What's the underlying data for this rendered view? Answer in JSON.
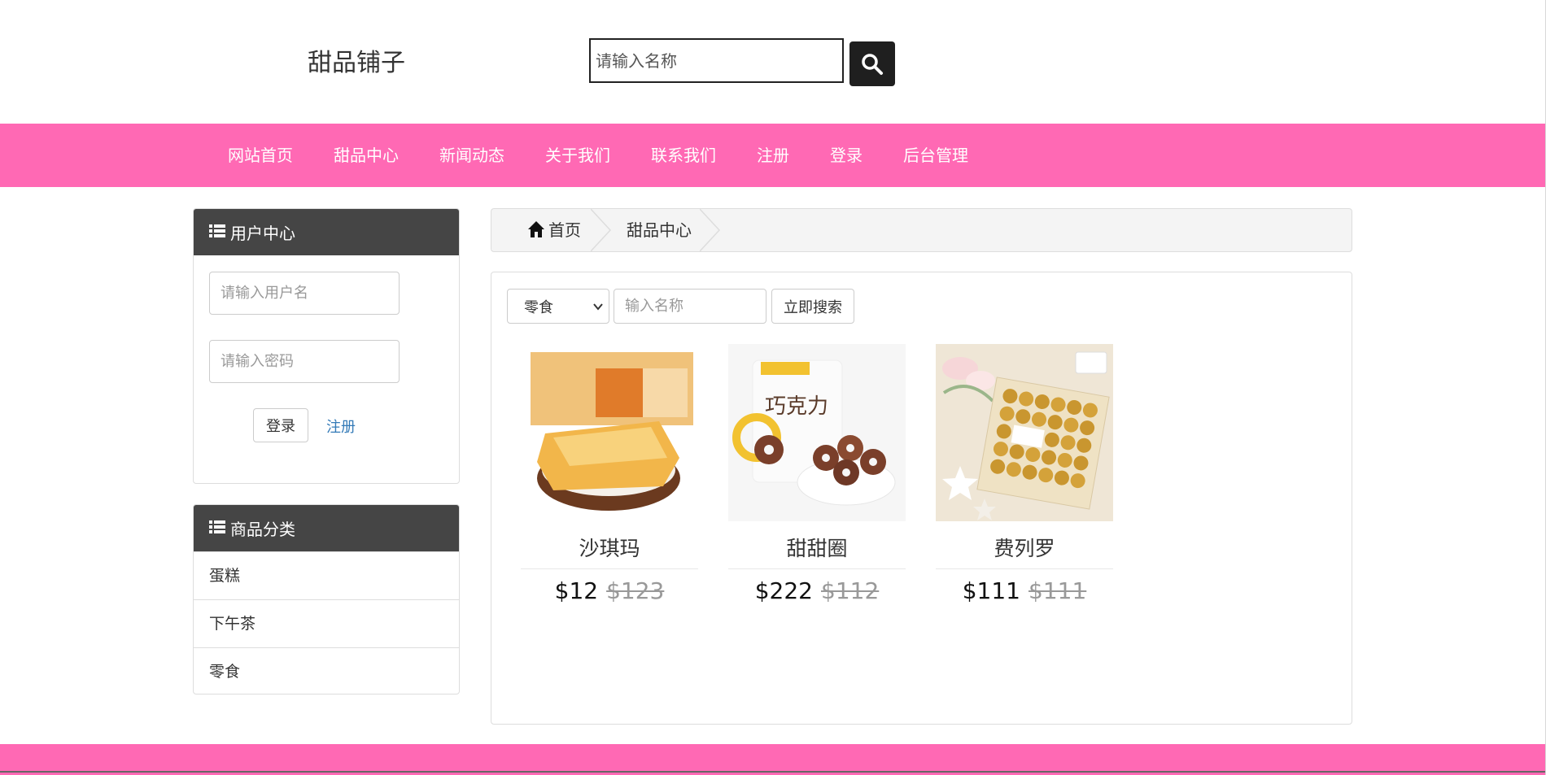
{
  "header": {
    "site_title": "甜品铺子",
    "search_placeholder": "请输入名称"
  },
  "nav": {
    "items": [
      "网站首页",
      "甜品中心",
      "新闻动态",
      "关于我们",
      "联系我们",
      "注册",
      "登录",
      "后台管理"
    ]
  },
  "user_panel": {
    "title": "用户中心",
    "username_placeholder": "请输入用户名",
    "password_placeholder": "请输入密码",
    "login_label": "登录",
    "register_label": "注册"
  },
  "category_panel": {
    "title": "商品分类",
    "items": [
      "蛋糕",
      "下午茶",
      "零食"
    ]
  },
  "breadcrumb": {
    "home": "首页",
    "current": "甜品中心"
  },
  "filter": {
    "selected_category": "零食",
    "name_placeholder": "输入名称",
    "search_button": "立即搜索"
  },
  "products": [
    {
      "name": "沙琪玛",
      "price": "$12",
      "old_price": "$123"
    },
    {
      "name": "甜甜圈",
      "price": "$222",
      "old_price": "$112"
    },
    {
      "name": "费列罗",
      "price": "$111",
      "old_price": "$111"
    }
  ],
  "colors": {
    "accent": "#ff69b4",
    "panel_header": "#454545",
    "link": "#337ab7"
  }
}
